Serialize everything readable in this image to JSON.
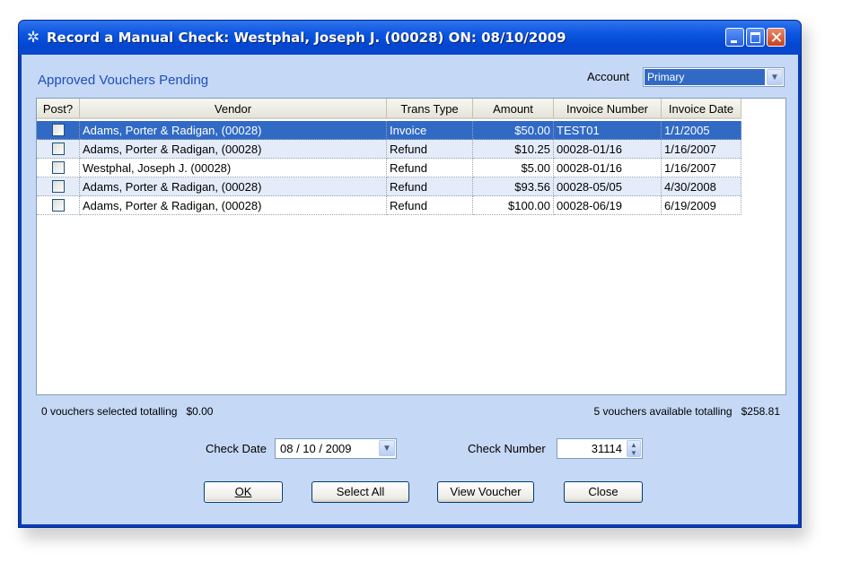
{
  "window": {
    "title": "Record a Manual Check: Westphal, Joseph J. (00028) ON: 08/10/2009",
    "icon": "gear-icon"
  },
  "section_title": "Approved Vouchers Pending",
  "account": {
    "label": "Account",
    "value": "Primary"
  },
  "table": {
    "columns": [
      "Post?",
      "Vendor",
      "Trans Type",
      "Amount",
      "Invoice Number",
      "Invoice Date"
    ],
    "rows": [
      {
        "post": false,
        "vendor": "Adams, Porter & Radigan, (00028)",
        "trans_type": "Invoice",
        "amount": "$50.00",
        "invoice_number": "TEST01",
        "invoice_date": "1/1/2005"
      },
      {
        "post": false,
        "vendor": "Adams, Porter & Radigan, (00028)",
        "trans_type": "Refund",
        "amount": "$10.25",
        "invoice_number": "00028-01/16",
        "invoice_date": "1/16/2007"
      },
      {
        "post": false,
        "vendor": "Westphal, Joseph J. (00028)",
        "trans_type": "Refund",
        "amount": "$5.00",
        "invoice_number": "00028-01/16",
        "invoice_date": "1/16/2007"
      },
      {
        "post": false,
        "vendor": "Adams, Porter & Radigan, (00028)",
        "trans_type": "Refund",
        "amount": "$93.56",
        "invoice_number": "00028-05/05",
        "invoice_date": "4/30/2008"
      },
      {
        "post": false,
        "vendor": "Adams, Porter & Radigan, (00028)",
        "trans_type": "Refund",
        "amount": "$100.00",
        "invoice_number": "00028-06/19",
        "invoice_date": "6/19/2009"
      }
    ]
  },
  "summary": {
    "selected_text": "0 vouchers selected totalling",
    "selected_total": "$0.00",
    "available_text": "5 vouchers available totalling",
    "available_total": "$258.81"
  },
  "check_date": {
    "label": "Check Date",
    "value": "08 / 10 / 2009"
  },
  "check_number": {
    "label": "Check Number",
    "value": "31114"
  },
  "buttons": {
    "ok": "OK",
    "select_all": "Select All",
    "view_voucher": "View Voucher",
    "close": "Close"
  }
}
